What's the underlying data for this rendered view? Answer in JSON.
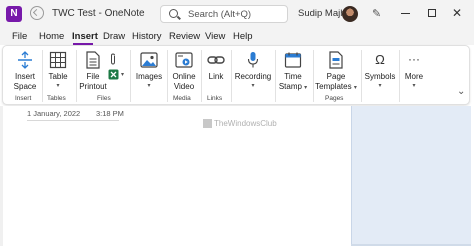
{
  "window": {
    "title": "TWC Test - OneNote",
    "app_icon_text": "N",
    "search_placeholder": "Search (Alt+Q)",
    "user_name": "Sudip Majhi",
    "controls": [
      "minimize",
      "maximize",
      "close"
    ],
    "close_glyph": "✕",
    "pen_glyph": "✎"
  },
  "tabs": [
    {
      "label": "File"
    },
    {
      "label": "Home"
    },
    {
      "label": "Insert",
      "active": true
    },
    {
      "label": "Draw"
    },
    {
      "label": "History"
    },
    {
      "label": "Review"
    },
    {
      "label": "View"
    },
    {
      "label": "Help"
    }
  ],
  "ribbon": {
    "insert_space": {
      "line1": "Insert",
      "line2": "Space"
    },
    "table": {
      "label": "Table"
    },
    "file_printout": {
      "line1": "File",
      "line2": "Printout"
    },
    "images": {
      "label": "Images"
    },
    "online_video": {
      "line1": "Online",
      "line2": "Video"
    },
    "link": {
      "label": "Link"
    },
    "recording": {
      "label": "Recording"
    },
    "time_stamp": {
      "line1": "Time",
      "line2": "Stamp"
    },
    "page_templates": {
      "line1": "Page",
      "line2": "Templates"
    },
    "symbols": {
      "label": "Symbols"
    },
    "more": {
      "label": "More"
    },
    "groups": {
      "insert": "Insert",
      "tables": "Tables",
      "files": "Files",
      "media": "Media",
      "links": "Links",
      "pages": "Pages"
    },
    "collapse_glyph": "⌄",
    "accent": "#7719aa"
  },
  "page": {
    "date": "1 January, 2022",
    "time": "3:18 PM",
    "watermark": "TheWindowsClub",
    "side_panel_color": "#e3ebf6"
  }
}
